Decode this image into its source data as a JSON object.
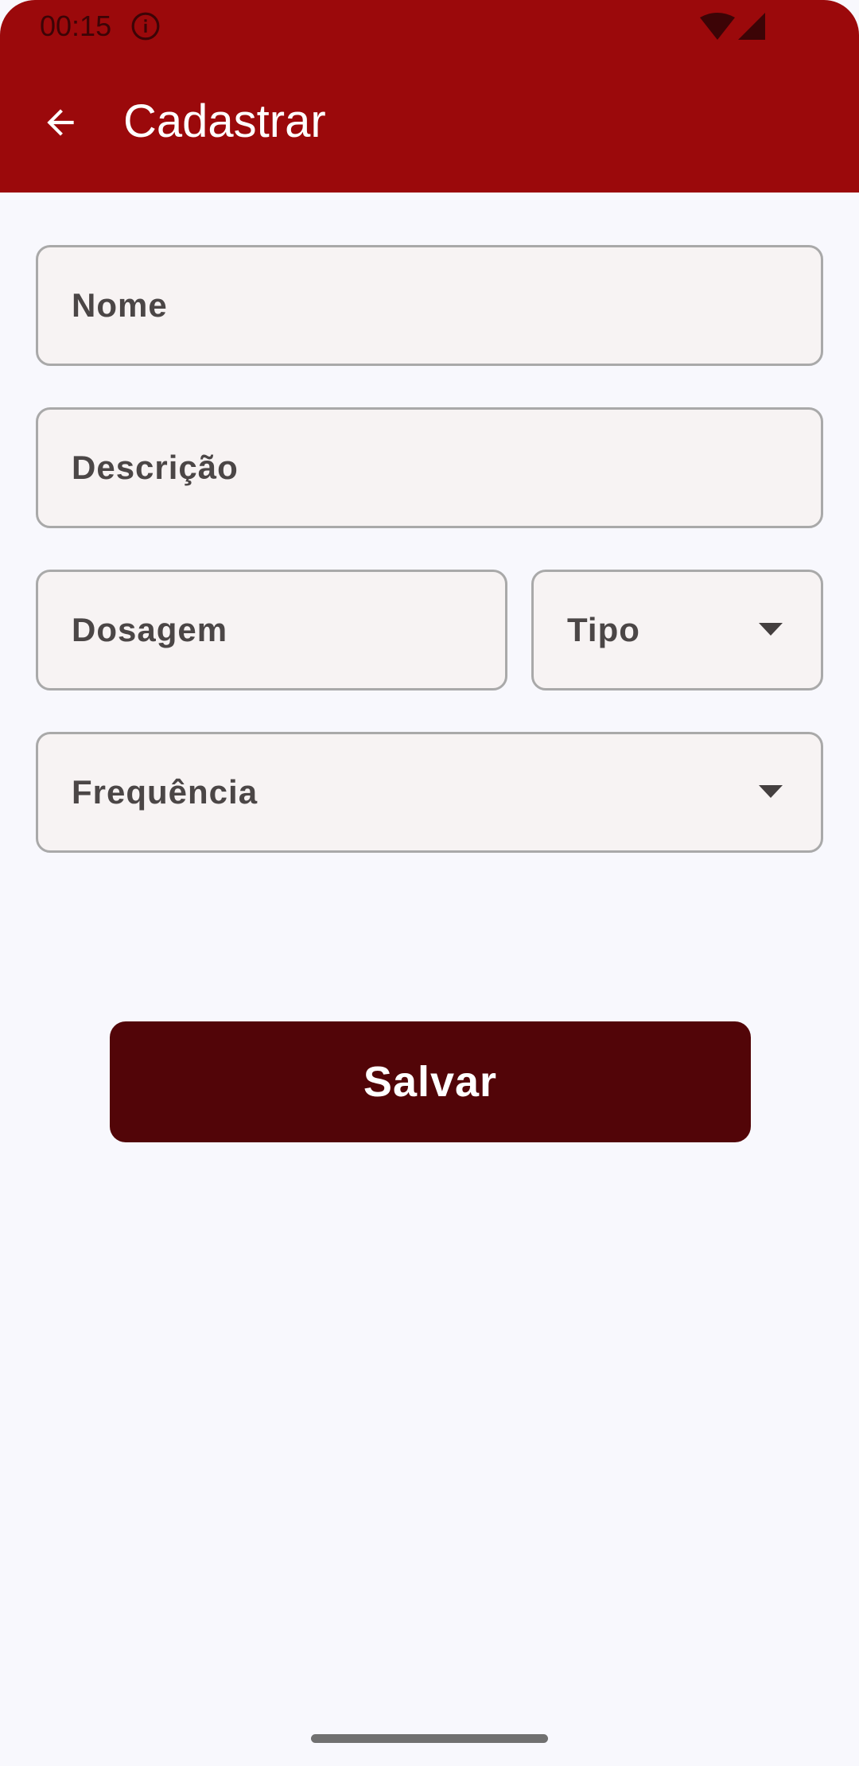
{
  "status_bar": {
    "time": "00:15",
    "icons": [
      "info-icon",
      "wifi-icon",
      "signal-icon"
    ]
  },
  "app_bar": {
    "title": "Cadastrar",
    "back_icon": "arrow-back-icon"
  },
  "form": {
    "nome_label": "Nome",
    "descricao_label": "Descrição",
    "dosagem_label": "Dosagem",
    "tipo_label": "Tipo",
    "frequencia_label": "Frequência"
  },
  "actions": {
    "save_label": "Salvar"
  },
  "colors": {
    "app_bar": "#9b090b",
    "save_button": "#520508",
    "background": "#f8f8fd",
    "field_background": "#f7f3f3",
    "field_border": "#a9a9a9"
  }
}
